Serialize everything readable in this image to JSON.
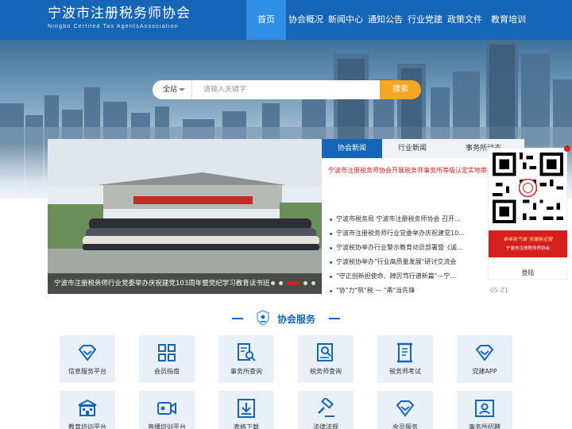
{
  "header": {
    "logo_cn": "宁波市注册税务师协会",
    "logo_en": "Ningbo Certifed  Tax AgentsAssociation",
    "nav": [
      {
        "label": "首页",
        "active": true
      },
      {
        "label": "协会概况",
        "active": false
      },
      {
        "label": "新闻中心",
        "active": false
      },
      {
        "label": "通知公告",
        "active": false
      },
      {
        "label": "行业党建",
        "active": false
      },
      {
        "label": "政策文件",
        "active": false
      },
      {
        "label": "教育培训",
        "active": false
      }
    ]
  },
  "search": {
    "scope": "全站",
    "placeholder": "请输入关键字",
    "button": "搜索"
  },
  "slider": {
    "caption": "宁波市注册税务师行业党委举办庆祝建党103周年暨党纪学习教育读书班",
    "dots": 5,
    "active_dot": 3
  },
  "news": {
    "tabs": [
      "协会新闻",
      "行业新闻",
      "事务所动态"
    ],
    "active_tab": 0,
    "headline": "宁波市注册税务师协会开展税务师事务所等级认定实地审核检查工作",
    "items": [
      {
        "title": "宁波市税务局 宁波市注册税务师协会 召开…",
        "date": ""
      },
      {
        "title": "宁波市注册税务师行业党委举办庆祝建党10…",
        "date": ""
      },
      {
        "title": "宁波税协举办行业警示教育动员部署暨《诚…",
        "date": ""
      },
      {
        "title": "宁波税协举办\"行业高质量发展\"研讨交流会",
        "date": ""
      },
      {
        "title": "\"守正创新担使命、踔厉笃行谱新篇\"—宁…",
        "date": ""
      },
      {
        "title": "\"协\"力\"筑\"税 — \"甬\"当先锋",
        "date": "05-21"
      }
    ]
  },
  "qr": {
    "promo_line1": "新年新气象 党建新征程",
    "promo_line2": "宁波市注册税务师协会",
    "label": "登陆"
  },
  "services": {
    "title": "协会服务",
    "items": [
      {
        "label": "信息服务平台",
        "icon": "heart-diamond-icon"
      },
      {
        "label": "会员指南",
        "icon": "grid-icon"
      },
      {
        "label": "事务所查询",
        "icon": "document-search-icon"
      },
      {
        "label": "税务师查询",
        "icon": "person-search-icon"
      },
      {
        "label": "税务师考试",
        "icon": "scroll-icon"
      },
      {
        "label": "党建APP",
        "icon": "heart-diamond-icon"
      },
      {
        "label": "教育培训平台",
        "icon": "building-icon"
      },
      {
        "label": "直播培训平台",
        "icon": "video-icon"
      },
      {
        "label": "表格下载",
        "icon": "download-icon"
      },
      {
        "label": "法律法规",
        "icon": "gavel-icon"
      },
      {
        "label": "会员服务",
        "icon": "heart-diamond-icon"
      },
      {
        "label": "事务所招聘",
        "icon": "id-card-icon"
      }
    ]
  },
  "colors": {
    "primary": "#1565b8",
    "nav_active": "#2f8fe6",
    "accent": "#f5a623",
    "alert": "#d62020",
    "tile_bg": "#e9f0f8"
  }
}
